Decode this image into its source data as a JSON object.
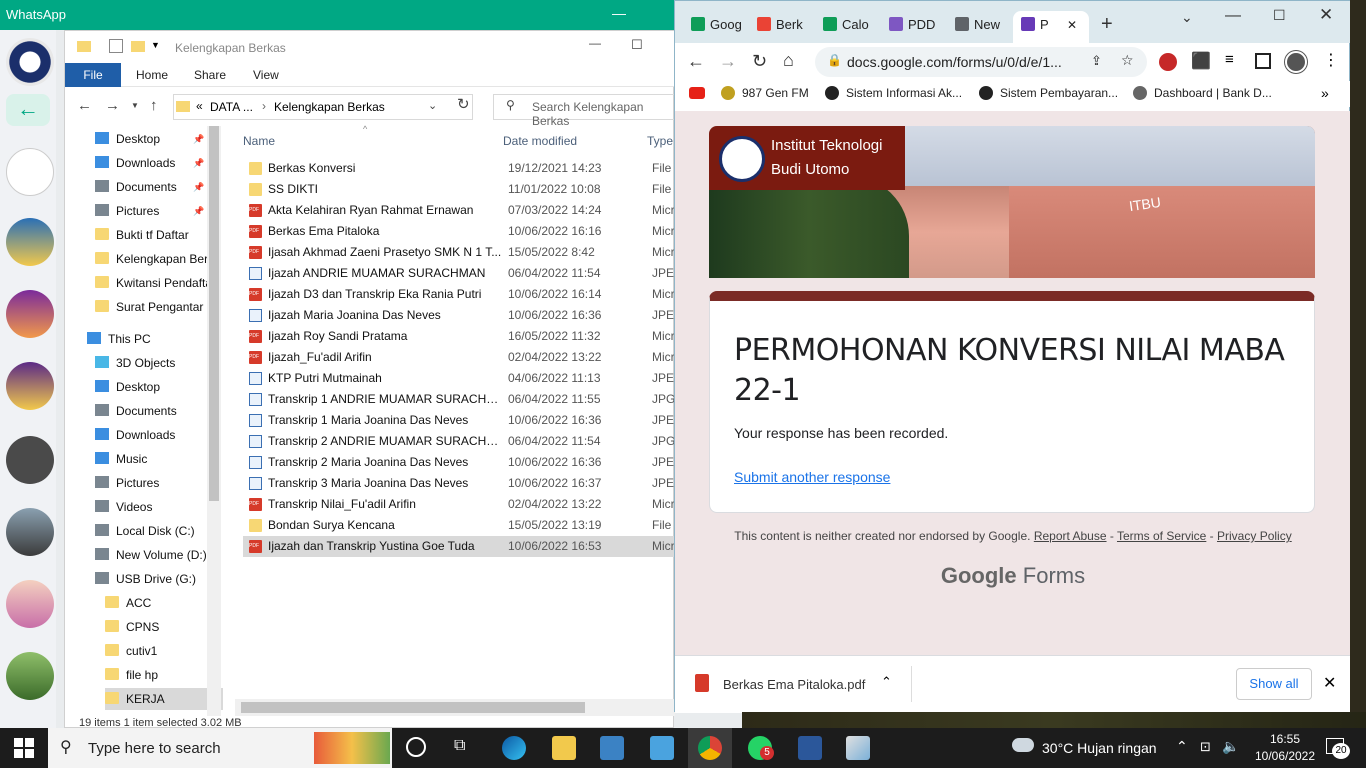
{
  "whatsapp": {
    "title": "WhatsApp",
    "ctrl_min": "—",
    "ctrl_max": "▢"
  },
  "explorer": {
    "title": "Kelengkapan Berkas",
    "ribbon": {
      "file": "File",
      "home": "Home",
      "share": "Share",
      "view": "View"
    },
    "address": {
      "prefix": "«",
      "seg1": "DATA ...",
      "sep": "›",
      "seg2": "Kelengkapan Berkas"
    },
    "search_placeholder": "Search Kelengkapan Berkas",
    "nav": [
      {
        "label": "Desktop",
        "icon": "blue",
        "pin": true
      },
      {
        "label": "Downloads",
        "icon": "blue",
        "pin": true
      },
      {
        "label": "Documents",
        "icon": "grey",
        "pin": true
      },
      {
        "label": "Pictures",
        "icon": "grey",
        "pin": true
      },
      {
        "label": "Bukti tf Daftar",
        "icon": "fold"
      },
      {
        "label": "Kelengkapan Berkas",
        "icon": "fold"
      },
      {
        "label": "Kwitansi Pendaftaran",
        "icon": "fold"
      },
      {
        "label": "Surat Pengantar",
        "icon": "fold"
      },
      {
        "label": "This PC",
        "icon": "blue"
      },
      {
        "label": "3D Objects",
        "icon": "cyan"
      },
      {
        "label": "Desktop",
        "icon": "blue"
      },
      {
        "label": "Documents",
        "icon": "grey"
      },
      {
        "label": "Downloads",
        "icon": "blue"
      },
      {
        "label": "Music",
        "icon": "blue"
      },
      {
        "label": "Pictures",
        "icon": "grey"
      },
      {
        "label": "Videos",
        "icon": "grey"
      },
      {
        "label": "Local Disk (C:)",
        "icon": "grey"
      },
      {
        "label": "New Volume (D:)",
        "icon": "grey"
      },
      {
        "label": "USB Drive (G:)",
        "icon": "grey"
      },
      {
        "label": "ACC",
        "icon": "fold"
      },
      {
        "label": "CPNS",
        "icon": "fold"
      },
      {
        "label": "cutiv1",
        "icon": "fold"
      },
      {
        "label": "file hp",
        "icon": "fold"
      },
      {
        "label": "KERJA",
        "icon": "fold"
      }
    ],
    "columns": {
      "name": "Name",
      "date": "Date modified",
      "type": "Type"
    },
    "files": [
      {
        "name": "Berkas Konversi",
        "date": "19/12/2021 14:23",
        "type": "File folder",
        "icon": "fold"
      },
      {
        "name": "SS DIKTI",
        "date": "11/01/2022 10:08",
        "type": "File folder",
        "icon": "fold"
      },
      {
        "name": "Akta Kelahiran Ryan Rahmat Ernawan",
        "date": "07/03/2022 14:24",
        "type": "Microsoft",
        "icon": "pdf"
      },
      {
        "name": "Berkas Ema Pitaloka",
        "date": "10/06/2022 16:16",
        "type": "Microsoft",
        "icon": "pdf"
      },
      {
        "name": "Ijasah Akhmad Zaeni Prasetyo SMK N 1 T...",
        "date": "15/05/2022 8:42",
        "type": "Microsoft",
        "icon": "pdf"
      },
      {
        "name": "Ijazah ANDRIE MUAMAR SURACHMAN",
        "date": "06/04/2022 11:54",
        "type": "JPEG",
        "icon": "img"
      },
      {
        "name": "Ijazah D3 dan Transkrip Eka Rania Putri",
        "date": "10/06/2022 16:14",
        "type": "Microsoft",
        "icon": "pdf"
      },
      {
        "name": "Ijazah Maria Joanina Das Neves",
        "date": "10/06/2022 16:36",
        "type": "JPEG",
        "icon": "img"
      },
      {
        "name": "Ijazah Roy Sandi Pratama",
        "date": "16/05/2022 11:32",
        "type": "Microsoft",
        "icon": "pdf"
      },
      {
        "name": "Ijazah_Fu'adil Arifin",
        "date": "02/04/2022 13:22",
        "type": "Microsoft",
        "icon": "pdf"
      },
      {
        "name": "KTP Putri Mutmainah",
        "date": "04/06/2022 11:13",
        "type": "JPEG",
        "icon": "img"
      },
      {
        "name": "Transkrip 1 ANDRIE MUAMAR SURACHM...",
        "date": "06/04/2022 11:55",
        "type": "JPG File",
        "icon": "img"
      },
      {
        "name": "Transkrip 1 Maria Joanina Das Neves",
        "date": "10/06/2022 16:36",
        "type": "JPEG",
        "icon": "img"
      },
      {
        "name": "Transkrip 2 ANDRIE MUAMAR SURACHM...",
        "date": "06/04/2022 11:54",
        "type": "JPG File",
        "icon": "img"
      },
      {
        "name": "Transkrip 2 Maria Joanina Das Neves",
        "date": "10/06/2022 16:36",
        "type": "JPEG",
        "icon": "img"
      },
      {
        "name": "Transkrip 3 Maria Joanina Das Neves",
        "date": "10/06/2022 16:37",
        "type": "JPEG",
        "icon": "img"
      },
      {
        "name": "Transkrip Nilai_Fu'adil Arifin",
        "date": "02/04/2022 13:22",
        "type": "Microsoft",
        "icon": "pdf"
      },
      {
        "name": "Bondan Surya Kencana",
        "date": "15/05/2022 13:19",
        "type": "File folder",
        "icon": "fold"
      },
      {
        "name": "Ijazah dan Transkrip Yustina Goe Tuda",
        "date": "10/06/2022 16:53",
        "type": "Microsoft",
        "icon": "pdf",
        "selected": true
      }
    ],
    "status": "19 items     1 item selected  3.02 MB"
  },
  "chrome": {
    "tabs": [
      {
        "label": "Goog",
        "color": "#0f9d58"
      },
      {
        "label": "Berk",
        "color": "#ea4335"
      },
      {
        "label": "Calo",
        "color": "#0f9d58"
      },
      {
        "label": "PDD",
        "color": "#7e57c2"
      },
      {
        "label": "New",
        "color": "#5f6368"
      },
      {
        "label": "P",
        "color": "#673ab7",
        "active": true
      }
    ],
    "url": "docs.google.com/forms/u/0/d/e/1...",
    "bookmarks": [
      "987 Gen FM",
      "Sistem Informasi Ak...",
      "Sistem Pembayaran...",
      "Dashboard | Bank D..."
    ],
    "banner": {
      "line1": "Institut Teknologi",
      "line2": "Budi Utomo",
      "building_text": "ITBU"
    },
    "form": {
      "title": "PERMOHONAN KONVERSI NILAI MABA 22-1",
      "message": "Your response has been recorded.",
      "again": "Submit another response"
    },
    "footer": {
      "prefix": "This content is neither created nor endorsed by Google.",
      "report": "Report Abuse",
      "terms": "Terms of Service",
      "privacy": "Privacy Policy",
      "brand_google": "Google",
      "brand_forms": "Forms"
    },
    "download": {
      "file": "Berkas Ema Pitaloka.pdf",
      "show_all": "Show all"
    }
  },
  "taskbar": {
    "search": "Type here to search",
    "weather": "30°C  Hujan ringan",
    "time": "16:55",
    "date": "10/06/2022",
    "whatsapp_badge": "5",
    "notif_count": "20"
  }
}
